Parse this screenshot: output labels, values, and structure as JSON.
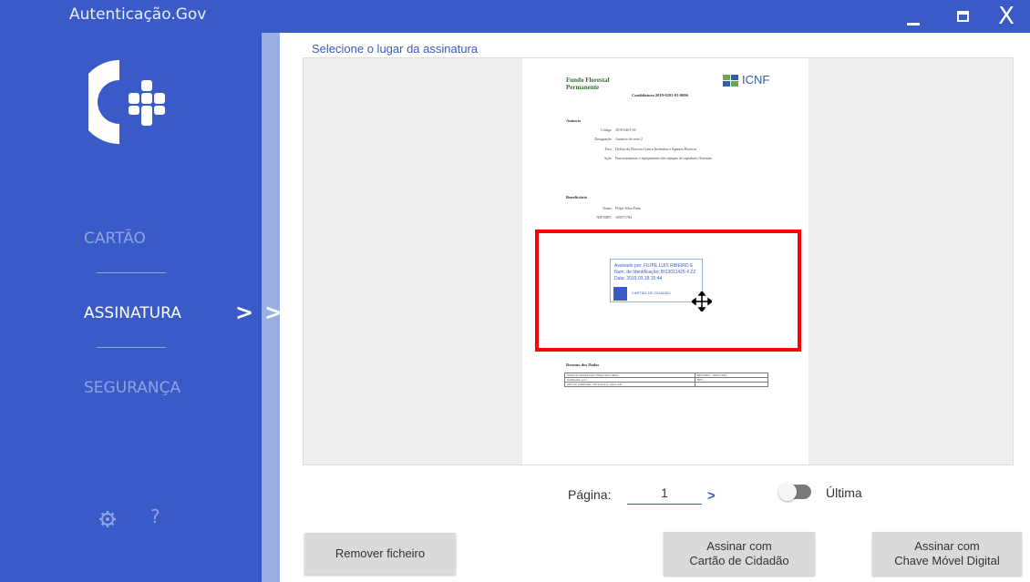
{
  "window": {
    "title": "Autenticação.Gov",
    "controls": {
      "minimize": "minimize",
      "maximize": "maximize",
      "close": "X"
    }
  },
  "sidebar": {
    "items": [
      {
        "label": "CARTÃO",
        "active": false
      },
      {
        "label": "ASSINATURA",
        "active": true
      },
      {
        "label": "SEGURANÇA",
        "active": false
      }
    ],
    "active_chevron": ">",
    "strip_chevron": ">",
    "footer": {
      "settings_icon": "gear-icon",
      "help_label": "?"
    }
  },
  "main": {
    "section_title": "Selecione o lugar da assinatura",
    "document": {
      "brand": "Fundo Florestal Permanente",
      "logo_text": "ICNF",
      "candidatura": "Candidatura 2019-0201-03-0006",
      "aviso_title": "Anúncio",
      "aviso_rows": [
        {
          "k": "Código",
          "v": "2019-0201-03"
        },
        {
          "k": "Designação",
          "v": "Anúncio de teste 2"
        },
        {
          "k": "Eixo",
          "v": "Defesa da Floresta Contra Incêndios e Agentes Bióticos"
        },
        {
          "k": "Ação",
          "v": "Funcionamento e equipamento das equipas de sapadores florestais"
        }
      ],
      "beneficiario_title": "Beneficiário",
      "beneficiario_rows": [
        {
          "k": "Nome",
          "v": "Filipe Silva Pinto"
        },
        {
          "k": "NIF/NIPC",
          "v": "169571784"
        }
      ],
      "signature_stamp": {
        "line1": "Assinado por: FILIPE LUIS RIBEIRO E",
        "line2": "Num. de Identificação: BI13011425 4 ZZ",
        "line3": "Data: 2019.03.18 15:44",
        "brand": "CARTÃO DE CIDADÃO"
      },
      "table_title": "Resumo dos Dados",
      "table_rows": [
        [
          "Nome do beneficiário: Filipe Silva Pinto",
          "NIF/NIPC: 169571784"
        ],
        [
          "Submetido por: -",
          "NIF: -"
        ],
        [
          "Data de submissão: Click here to enter text.",
          ""
        ]
      ]
    },
    "pagination": {
      "label": "Página:",
      "value": "1",
      "next": ">",
      "last_toggle_label": "Última",
      "last_toggle_on": false
    },
    "buttons": {
      "remove": "Remover ficheiro",
      "sign_cc_line1": "Assinar com",
      "sign_cc_line2": "Cartão de Cidadão",
      "sign_cmd_line1": "Assinar com",
      "sign_cmd_line2": "Chave Móvel Digital"
    }
  },
  "colors": {
    "brand_blue": "#3a5bc7",
    "strip": "#9aaee3",
    "inactive_nav": "#8ea3e0",
    "signature_highlight": "#ff0000"
  }
}
